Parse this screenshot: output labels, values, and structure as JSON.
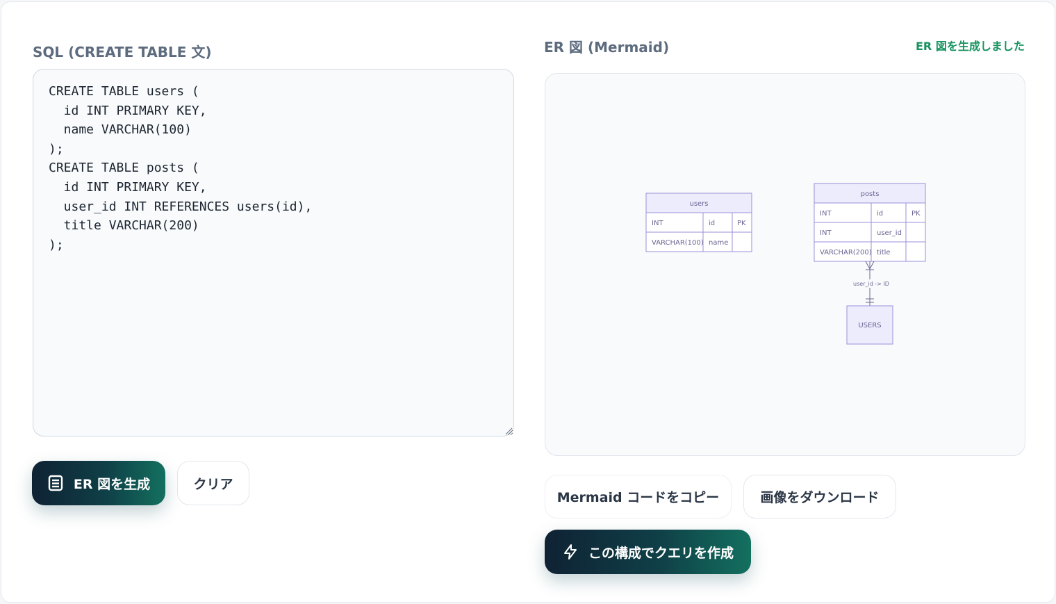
{
  "sql_panel": {
    "label": "SQL (CREATE TABLE 文)",
    "code": "CREATE TABLE users (\n  id INT PRIMARY KEY,\n  name VARCHAR(100)\n);\nCREATE TABLE posts (\n  id INT PRIMARY KEY,\n  user_id INT REFERENCES users(id),\n  title VARCHAR(200)\n);"
  },
  "buttons": {
    "generate": "ER 図を生成",
    "clear": "クリア",
    "copy_mermaid": "Mermaid コードをコピー",
    "download_image": "画像をダウンロード",
    "create_query": "この構成でクエリを作成"
  },
  "er_panel": {
    "label": "ER 図 (Mermaid)",
    "status": "ER 図を生成しました"
  },
  "diagram": {
    "users": {
      "name": "users",
      "rows": [
        {
          "type": "INT",
          "name": "id",
          "key": "PK"
        },
        {
          "type": "VARCHAR(100)",
          "name": "name",
          "key": ""
        }
      ]
    },
    "posts": {
      "name": "posts",
      "rows": [
        {
          "type": "INT",
          "name": "id",
          "key": "PK"
        },
        {
          "type": "INT",
          "name": "user_id",
          "key": ""
        },
        {
          "type": "VARCHAR(200)",
          "name": "title",
          "key": ""
        }
      ]
    },
    "relation_label": "user_id -> ID",
    "ref_entity": "USERS"
  },
  "colors": {
    "accent_green": "#17935f",
    "entity_header": "#ececfd",
    "entity_border": "#9b8fd8",
    "entity_row": "#ffffff"
  },
  "icons": {
    "generate": "document-list-icon",
    "create_query": "lightning-icon"
  }
}
